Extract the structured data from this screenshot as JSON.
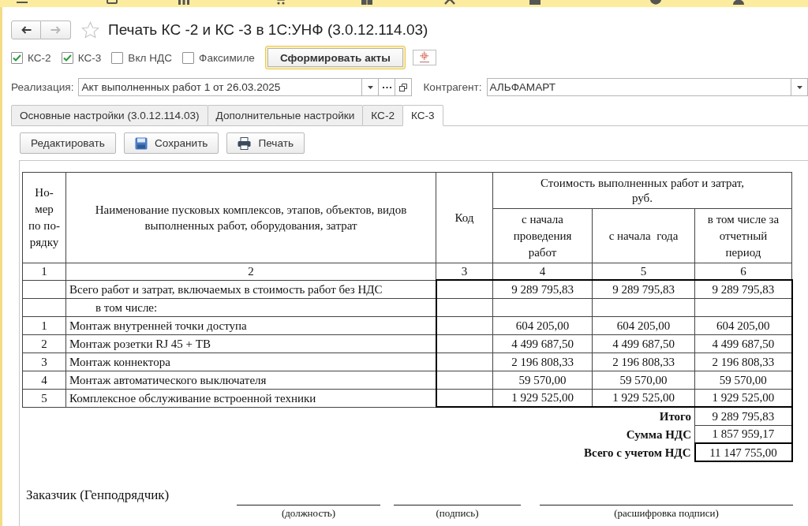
{
  "top_menu": [
    {
      "kind": "main"
    },
    {
      "kind": "crm"
    },
    {
      "kind": "sales"
    },
    {
      "kind": "purchases"
    },
    {
      "kind": "warehouse"
    },
    {
      "kind": "works"
    },
    {
      "kind": "production"
    },
    {
      "kind": "money"
    },
    {
      "kind": "staff"
    }
  ],
  "navigation": [
    {
      "kind": "back",
      "disabled": false
    },
    {
      "kind": "forward",
      "disabled": true
    }
  ],
  "window": {
    "title": "Печать КС -2 и КС -3 в 1С:УНФ (3.0.12.114.03)",
    "favorite": false
  },
  "options": [
    {
      "label": "КС-2",
      "checked": true
    },
    {
      "label": "КС-3",
      "checked": true
    },
    {
      "label": "Вкл НДС",
      "checked": false
    },
    {
      "label": "Факсимиле",
      "checked": false
    }
  ],
  "generate_button": {
    "label": "Сформировать акты"
  },
  "fields": [
    {
      "label": "Реализация:",
      "value": "Акт выполненных работ 1 от 26.03.2025",
      "choice_button": true,
      "open_button": true
    },
    {
      "label": "Контрагент:",
      "value": "АЛЬФАМАРТ"
    }
  ],
  "tabs": [
    {
      "label": "Основные настройки (3.0.12.114.03)",
      "selected": false
    },
    {
      "label": "Дополнительные настройки",
      "selected": false
    },
    {
      "label": "КС-2",
      "selected": false
    },
    {
      "label": "КС-3",
      "selected": true
    }
  ],
  "toolbar": [
    {
      "kind": "edit",
      "label": "Редактировать"
    },
    {
      "kind": "save",
      "label": "Сохранить"
    },
    {
      "kind": "print",
      "label": "Печать"
    }
  ],
  "document": {
    "table": {
      "columns": [
        {
          "title": "Но-\nмер\nпо по-\nрядку"
        },
        {
          "title": "Наименование пусковых комплексов, этапов, объектов, видов\nвыполненных работ, оборудования, затрат"
        },
        {
          "title": "Код"
        },
        {
          "title": "с начала\nпроведения\nработ"
        },
        {
          "title": "с начала  года"
        },
        {
          "title": "в том числе за\nотчетный\nпериод"
        }
      ],
      "column_group": {
        "title": "Стоимость выполненных работ и затрат,\nруб."
      },
      "column_numbers": [
        "1",
        "2",
        "3",
        "4",
        "5",
        "6"
      ],
      "rows": [
        {
          "kind": "total",
          "name": "Всего работ и затрат, включаемых в стоимость работ без НДС",
          "values": [
            "9 289 795,83",
            "9 289 795,83",
            "9 289 795,83"
          ]
        },
        {
          "kind": "subheading",
          "name": "в том числе:"
        },
        {
          "kind": "item",
          "number": "1",
          "name": "Монтаж внутренней точки доступа",
          "values": [
            "604 205,00",
            "604 205,00",
            "604 205,00"
          ]
        },
        {
          "kind": "item",
          "number": "2",
          "name": "Монтаж розетки RJ 45 + ТВ",
          "values": [
            "4 499 687,50",
            "4 499 687,50",
            "4 499 687,50"
          ]
        },
        {
          "kind": "item",
          "number": "3",
          "name": "Монтаж коннектора",
          "values": [
            "2 196 808,33",
            "2 196 808,33",
            "2 196 808,33"
          ]
        },
        {
          "kind": "item",
          "number": "4",
          "name": "Монтаж автоматического выключателя",
          "values": [
            "59 570,00",
            "59 570,00",
            "59 570,00"
          ]
        },
        {
          "kind": "item",
          "number": "5",
          "name": "Комплексное обслуживание встроенной техники",
          "values": [
            "1 929 525,00",
            "1 929 525,00",
            "1 929 525,00"
          ]
        }
      ],
      "totals": [
        {
          "kind": "subtotal",
          "label": "Итого",
          "value": "9 289 795,83"
        },
        {
          "kind": "subtotal",
          "label": "Сумма НДС",
          "value": "1 857 959,17"
        },
        {
          "kind": "grand_total",
          "label": "Всего с учетом НДС",
          "value": "11 147 755,00"
        }
      ]
    },
    "signature": {
      "label": "Заказчик (Генподрядчик)",
      "lines": [
        {
          "caption": "(должность)"
        },
        {
          "caption": "(подпись)"
        },
        {
          "caption": "(расшифровка подписи)"
        }
      ]
    }
  }
}
